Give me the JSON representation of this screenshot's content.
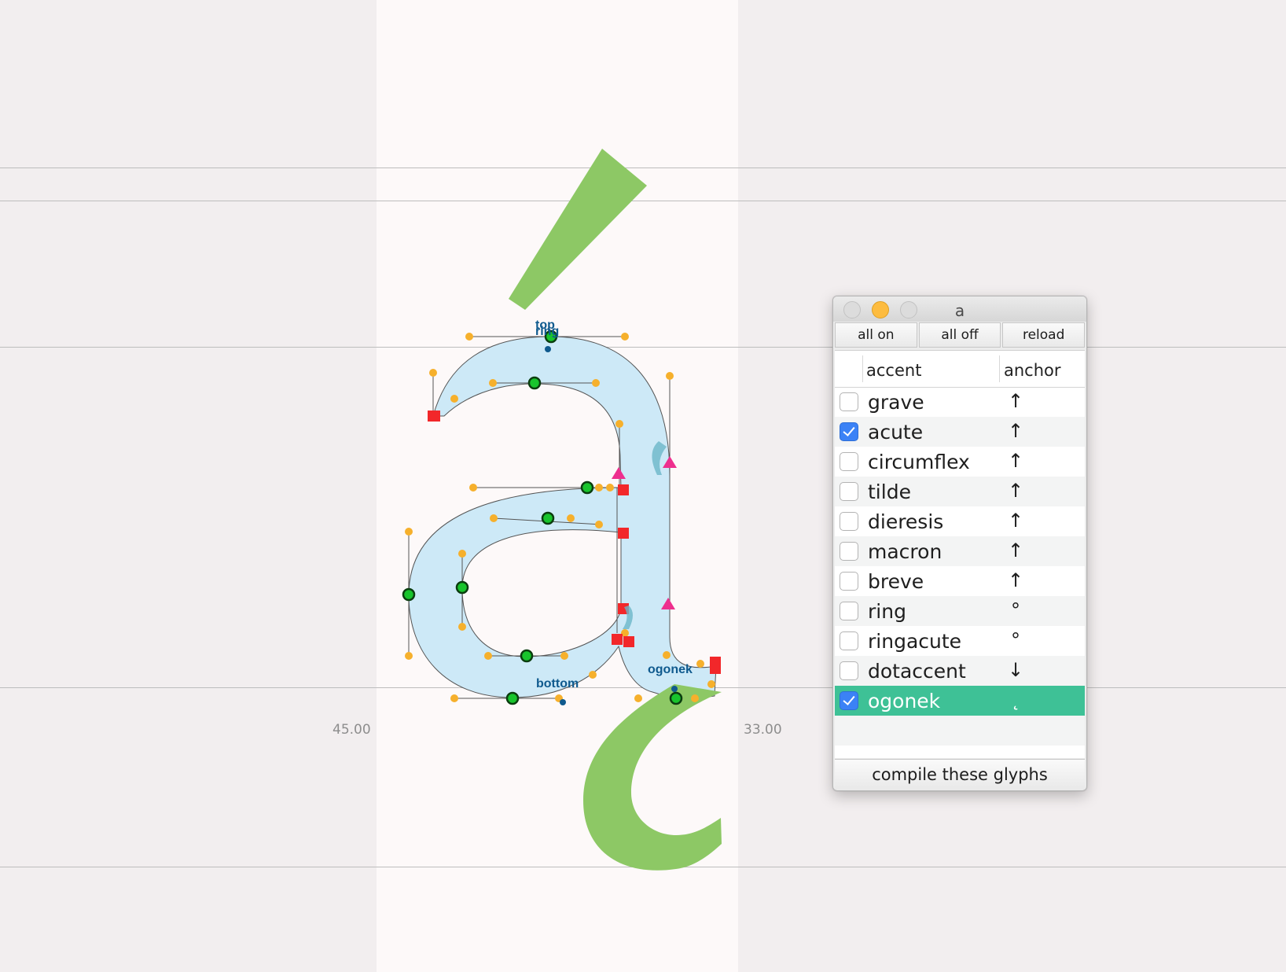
{
  "canvas": {
    "left_sidebearing": "45.00",
    "right_sidebearing": "33.00",
    "anchor_labels": {
      "top": "top",
      "ring": "ring",
      "bottom": "bottom",
      "ogonek": "ogonek"
    },
    "colors": {
      "background": "#f2eeef",
      "glyph_box": "#fdf9f9",
      "glyph_fill": "#cde9f7",
      "accent_fill": "#8dc865",
      "on_curve_point": "#18c42c",
      "off_curve_point": "#f6b02c",
      "corner_point": "#f2272a",
      "start_point": "#ee2f8e",
      "anchor": "#0f5a8e"
    }
  },
  "panel": {
    "title": "a",
    "buttons": {
      "all_on": "all on",
      "all_off": "all off",
      "reload": "reload"
    },
    "columns": {
      "accent": "accent",
      "anchor": "anchor"
    },
    "rows": [
      {
        "accent": "grave",
        "anchor": "↑",
        "checked": false
      },
      {
        "accent": "acute",
        "anchor": "↑",
        "checked": true
      },
      {
        "accent": "circumflex",
        "anchor": "↑",
        "checked": false
      },
      {
        "accent": "tilde",
        "anchor": "↑",
        "checked": false
      },
      {
        "accent": "dieresis",
        "anchor": "↑",
        "checked": false
      },
      {
        "accent": "macron",
        "anchor": "↑",
        "checked": false
      },
      {
        "accent": "breve",
        "anchor": "↑",
        "checked": false
      },
      {
        "accent": "ring",
        "anchor": "°",
        "checked": false
      },
      {
        "accent": "ringacute",
        "anchor": "°",
        "checked": false
      },
      {
        "accent": "dotaccent",
        "anchor": "↓",
        "checked": false
      },
      {
        "accent": "ogonek",
        "anchor": "˛",
        "checked": true,
        "selected": true
      }
    ],
    "compile_label": "compile these glyphs",
    "colors": {
      "selected_row": "#3ec196",
      "checkbox_on": "#3b82f6"
    }
  }
}
